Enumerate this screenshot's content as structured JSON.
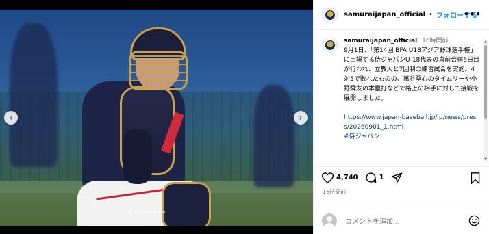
{
  "post": {
    "username": "samuraijapan_official",
    "follow_label": "フォローする",
    "more_label": "•••",
    "caption_time": "16時間前",
    "caption_text": "9月1日、「第14回 BFA U18アジア野球選手権」に出場する侍ジャパンU-18代表の直前合宿6日目が行われ、立教大と7回制の練習試合を実施。4対5で敗れたものの、萬谷堅心のタイムリーや小野舜友の本塁打などで格上の相手に対して接戦を展開しました。",
    "caption_link": "https://www.japan-baseball.jp/jp/news/press/20260901_1.html",
    "caption_tag": "#侍ジャパン",
    "likes": "4,740",
    "comments": "1",
    "posted_time": "16時間前",
    "comment_placeholder": "コメントを追加...",
    "accent_color": "#0095f6"
  },
  "media": {
    "carousel_dots": 8,
    "active_dot": 0
  }
}
